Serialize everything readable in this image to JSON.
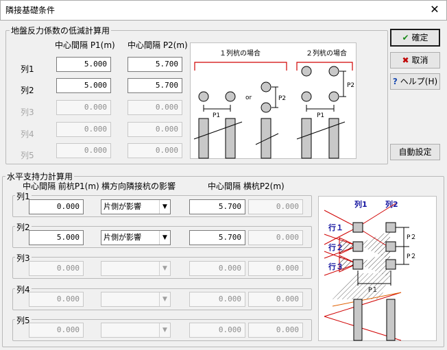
{
  "window": {
    "title": "隣接基礎条件"
  },
  "buttons": {
    "ok": "確定",
    "cancel": "取消",
    "help": "ヘルプ(H)",
    "auto": "自動設定"
  },
  "top_section": {
    "legend": "地盤反力係数の低減計算用",
    "col1_header": "中心間隔 P1(m)",
    "col2_header": "中心間隔 P2(m)",
    "rows": [
      {
        "label": "列1",
        "p1": "5.000",
        "p2": "5.700"
      },
      {
        "label": "列2",
        "p1": "5.000",
        "p2": "5.700"
      },
      {
        "label": "列3",
        "p1": "0.000",
        "p2": "0.000"
      },
      {
        "label": "列4",
        "p1": "0.000",
        "p2": "0.000"
      },
      {
        "label": "列5",
        "p1": "0.000",
        "p2": "0.000"
      }
    ],
    "diagram": {
      "case1": "１列杭の場合",
      "case2": "２列杭の場合",
      "or": "or",
      "p1": "P1",
      "p2": "P2"
    }
  },
  "bottom_section": {
    "legend": "水平支持力計算用",
    "col1_header": "中心間隔 前杭P1(m)",
    "col2_header": "横方向隣接杭の影響",
    "col3_header": "中心間隔 横杭P2(m)",
    "rows": [
      {
        "label": "列1",
        "p1": "0.000",
        "effect": "片側が影響",
        "p2a": "5.700",
        "p2b": "0.000"
      },
      {
        "label": "列2",
        "p1": "5.000",
        "effect": "片側が影響",
        "p2a": "5.700",
        "p2b": "0.000"
      },
      {
        "label": "列3",
        "p1": "0.000",
        "effect": "",
        "p2a": "0.000",
        "p2b": "0.000"
      },
      {
        "label": "列4",
        "p1": "0.000",
        "effect": "",
        "p2a": "0.000",
        "p2b": "0.000"
      },
      {
        "label": "列5",
        "p1": "0.000",
        "effect": "",
        "p2a": "0.000",
        "p2b": "0.000"
      }
    ],
    "diagram": {
      "col1": "列1",
      "col2": "列2",
      "row1": "行１",
      "row2": "行２",
      "row3": "行３",
      "p1": "P１",
      "p2a": "P２",
      "p2b": "P２"
    }
  },
  "colors": {
    "accent_blue": "#1515a0",
    "red": "#d00000",
    "orange": "#e06000"
  }
}
